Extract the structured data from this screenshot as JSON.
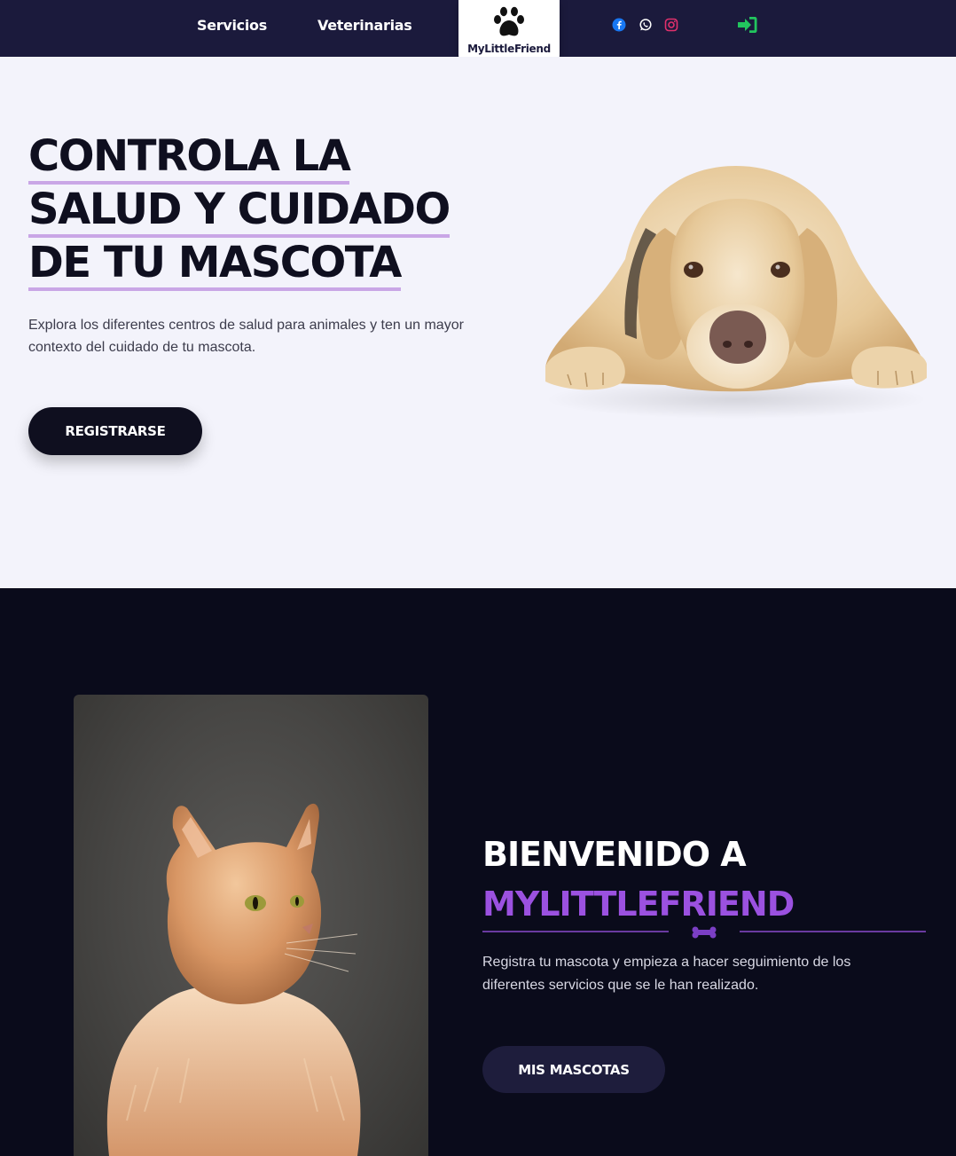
{
  "nav": {
    "links": [
      "Servicios",
      "Veterinarias"
    ],
    "logo_text": "MyLittleFriend",
    "social_icons": [
      "facebook-icon",
      "whatsapp-icon",
      "instagram-icon"
    ],
    "login_icon": "sign-in-icon"
  },
  "hero": {
    "title_lines": [
      "CONTROLA LA",
      "SALUD Y CUIDADO",
      "DE TU MASCOTA"
    ],
    "subtitle": "Explora los diferentes centros de salud para animales y ten un mayor contexto del cuidado de tu mascota.",
    "button_label": "REGISTRARSE",
    "image": "labrador-dog-lying-down"
  },
  "welcome": {
    "title_line1": "BIENVENIDO A",
    "title_brand": "MYLITTLEFRIEND",
    "text": "Registra tu mascota y empieza a hacer seguimiento de los diferentes servicios que se le han realizado.",
    "button_label": "MIS MASCOTAS",
    "image": "orange-maine-coon-cat"
  },
  "colors": {
    "nav_bg": "#1b1a3c",
    "hero_bg": "#f3f3fb",
    "underline": "#c9a6e6",
    "dark_bg": "#0a0b1b",
    "brand_purple": "#9b51e0",
    "facebook": "#1877f2",
    "instagram": "#e1306c",
    "login_green": "#22c55e"
  }
}
